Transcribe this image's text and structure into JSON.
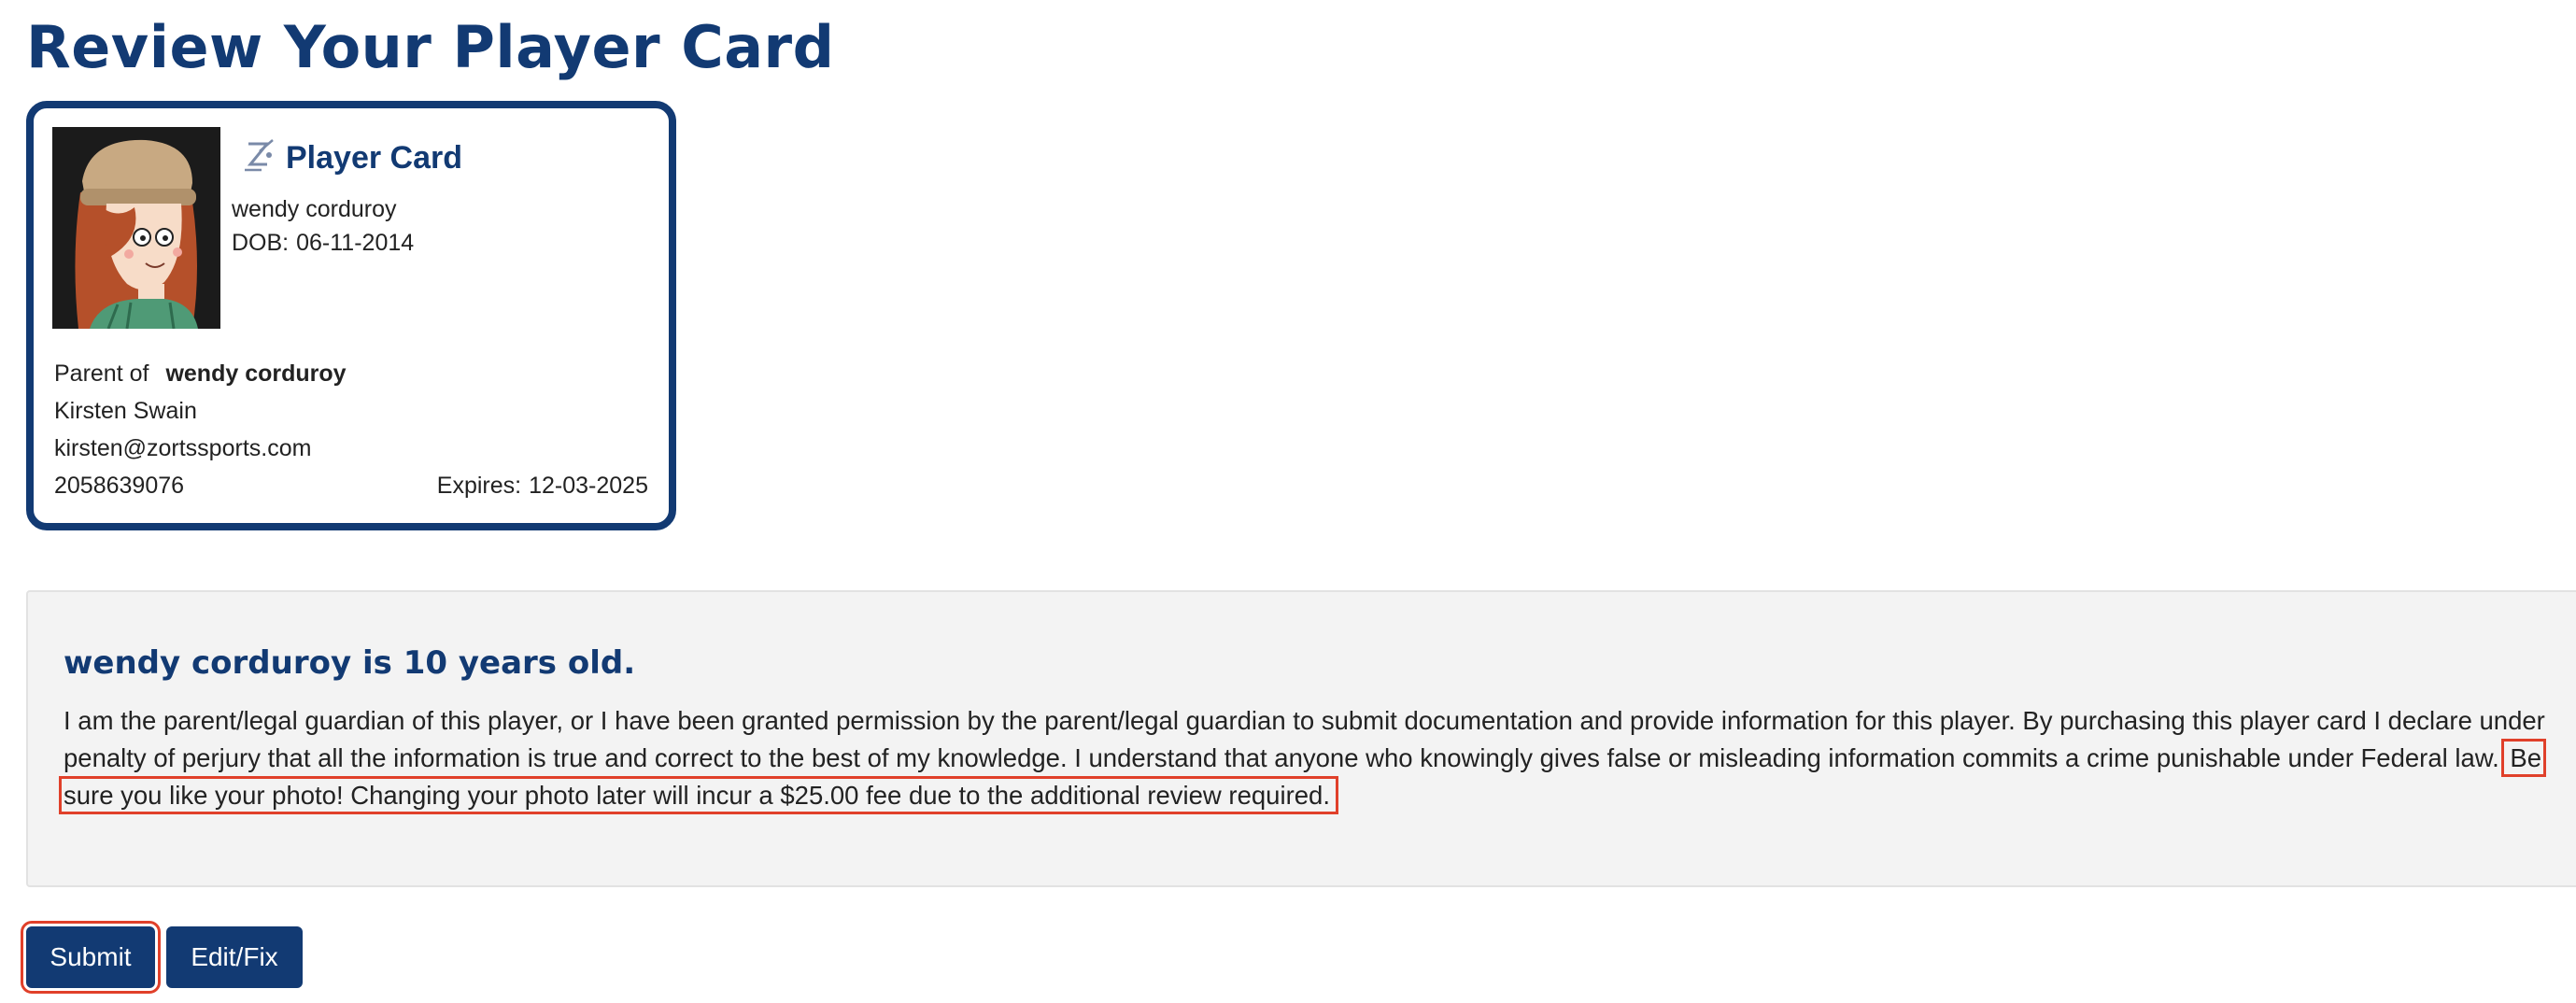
{
  "page": {
    "title": "Review Your Player Card"
  },
  "card": {
    "title": "Player Card",
    "logo_icon": "zorts-logo-icon",
    "photo_icon": "player-photo",
    "player_name": "wendy corduroy",
    "dob_label": "DOB:",
    "dob": "06-11-2014",
    "parent_of_label": "Parent of",
    "parent_of_name": "wendy corduroy",
    "parent_name": "Kirsten Swain",
    "parent_email": "kirsten@zortssports.com",
    "parent_phone": "2058639076",
    "expires_label": "Expires:",
    "expires": "12-03-2025"
  },
  "notice": {
    "heading": "wendy corduroy is 10 years old.",
    "body": "I am the parent/legal guardian of this player, or I have been granted permission by the parent/legal guardian to submit documentation and provide information for this player. By purchasing this player card I declare under penalty of perjury that all the information is true and correct to the best of my knowledge. I understand that anyone who knowingly gives false or misleading information commits a crime punishable under Federal law.",
    "highlight": "Be sure you like your photo! Changing your photo later will incur a $25.00 fee due to the additional review required."
  },
  "actions": {
    "submit_label": "Submit",
    "edit_label": "Edit/Fix"
  },
  "colors": {
    "brand": "#123a73",
    "highlight_border": "#e0402a",
    "panel_bg": "#f3f3f3"
  }
}
